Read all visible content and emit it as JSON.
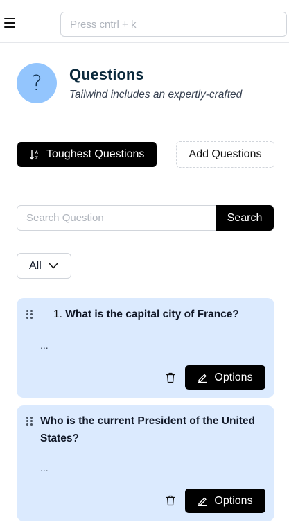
{
  "header": {
    "command_placeholder": "Press cntrl + k"
  },
  "page": {
    "icon_glyph": "?",
    "title": "Questions",
    "subtitle": "Tailwind includes an expertly-crafted"
  },
  "actions": {
    "toughest_label": "Toughest Questions",
    "add_label": "Add Questions"
  },
  "search": {
    "placeholder": "Search Question",
    "button_label": "Search"
  },
  "filter": {
    "selected": "All"
  },
  "questions": [
    {
      "number": "1.",
      "text": "What is the capital city of France?",
      "preview": "...",
      "options_label": "Options"
    },
    {
      "number": "",
      "text": "Who is the current President of the United States?",
      "preview": "...",
      "options_label": "Options"
    }
  ],
  "colors": {
    "card_bg": "#dbeafe",
    "avatar_bg": "#93c5fd",
    "primary": "#000000",
    "title": "#0b2a3d"
  }
}
